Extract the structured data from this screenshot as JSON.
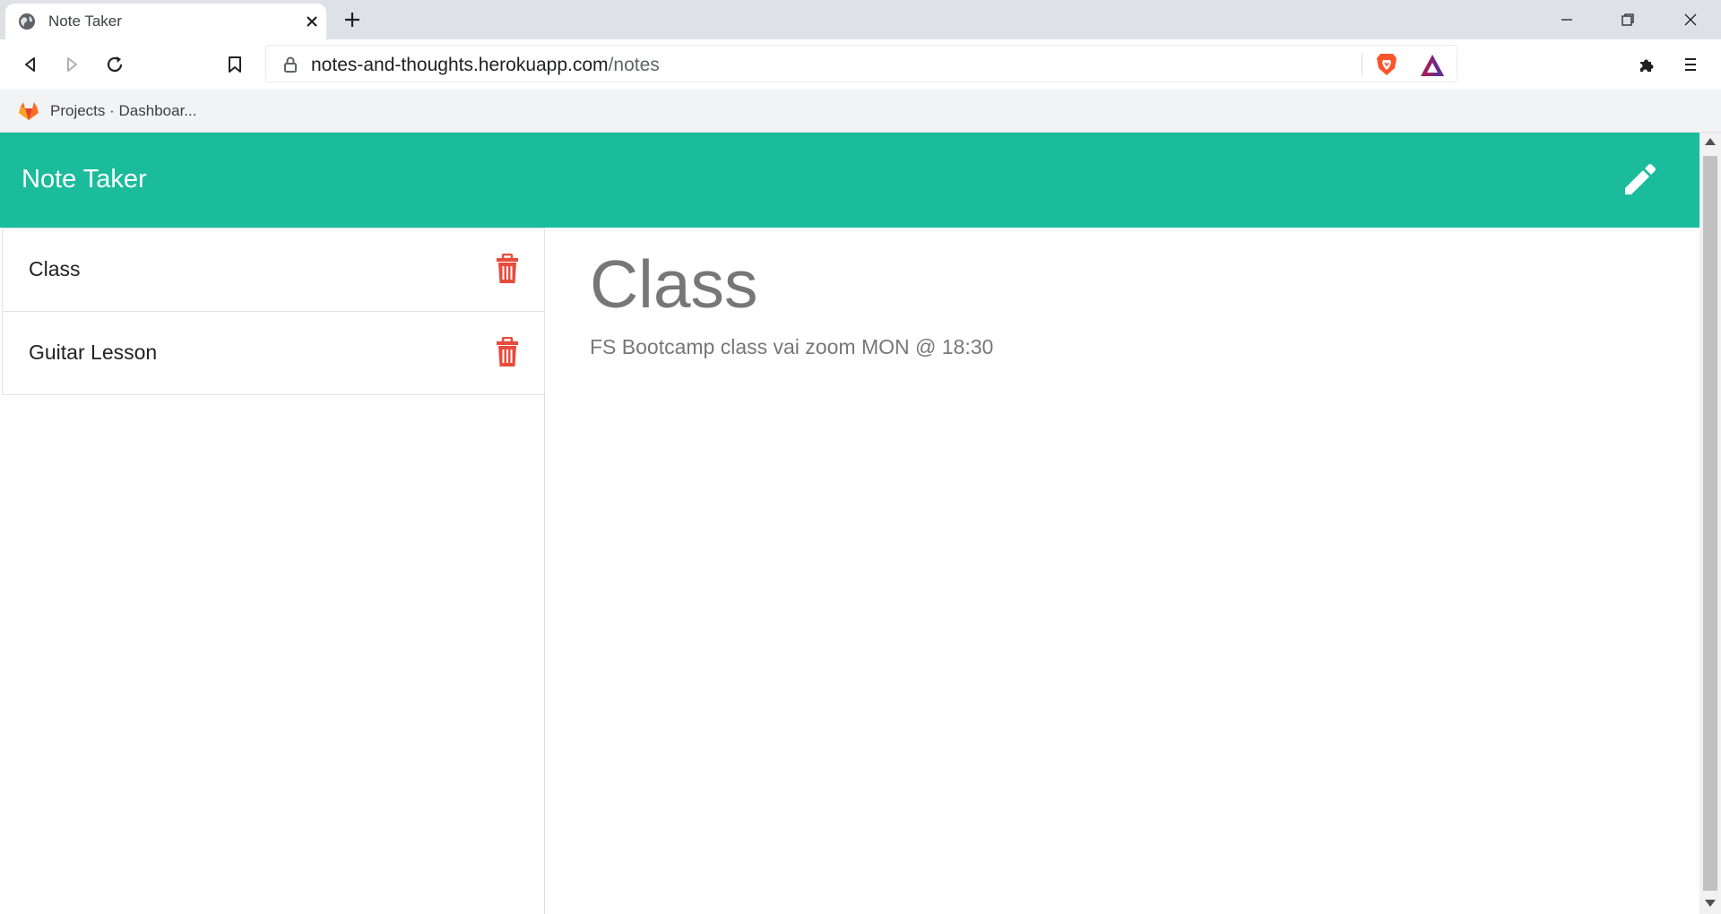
{
  "browser": {
    "tab_title": "Note Taker",
    "url_host": "notes-and-thoughts.herokuapp.com",
    "url_path": "/notes",
    "bookmarks": [
      {
        "label": "Projects · Dashboar...",
        "icon": "gitlab-icon"
      }
    ]
  },
  "app": {
    "brand": "Note Taker",
    "accent_color": "#1abc9c",
    "delete_color": "#e74c3c",
    "notes": [
      {
        "title": "Class"
      },
      {
        "title": "Guitar Lesson"
      }
    ],
    "active_note": {
      "title": "Class",
      "text": "FS Bootcamp class vai zoom MON @ 18:30"
    }
  }
}
